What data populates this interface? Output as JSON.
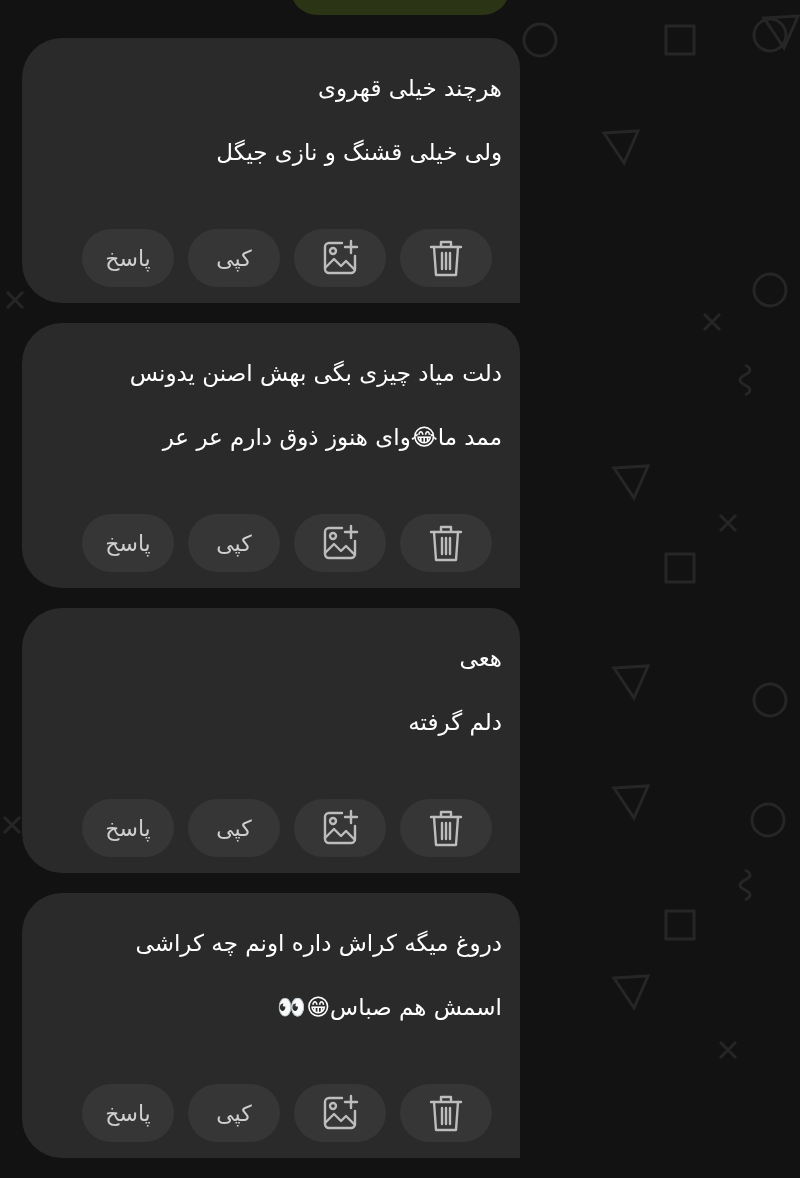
{
  "messages": [
    {
      "lines": [
        "هرچند خیلی قهروی",
        "ولی خیلی قشنگ و نازی جیگل"
      ],
      "actions": [
        {
          "kind": "delete"
        },
        {
          "kind": "image-add"
        },
        {
          "kind": "text",
          "label": "کپی"
        },
        {
          "kind": "text",
          "label": "پاسخ"
        }
      ]
    },
    {
      "lines": [
        "دلت میاد چیزی بگی بهش اصنن یدونس",
        "ممد ما😂وای هنوز ذوق دارم عر عر"
      ],
      "actions": [
        {
          "kind": "delete"
        },
        {
          "kind": "image-add"
        },
        {
          "kind": "text",
          "label": "کپی"
        },
        {
          "kind": "text",
          "label": "پاسخ"
        }
      ]
    },
    {
      "lines": [
        "هعی",
        "دلم گرفته"
      ],
      "actions": [
        {
          "kind": "delete"
        },
        {
          "kind": "image-add"
        },
        {
          "kind": "text",
          "label": "کپی"
        },
        {
          "kind": "text",
          "label": "پاسخ"
        }
      ]
    },
    {
      "lines": [
        "دروغ میگه کراش داره اونم چه کراشی",
        "اسمش هم صباس😁👀"
      ],
      "actions": [
        {
          "kind": "delete"
        },
        {
          "kind": "image-add"
        },
        {
          "kind": "text",
          "label": "کپی"
        },
        {
          "kind": "text",
          "label": "پاسخ"
        }
      ]
    }
  ]
}
